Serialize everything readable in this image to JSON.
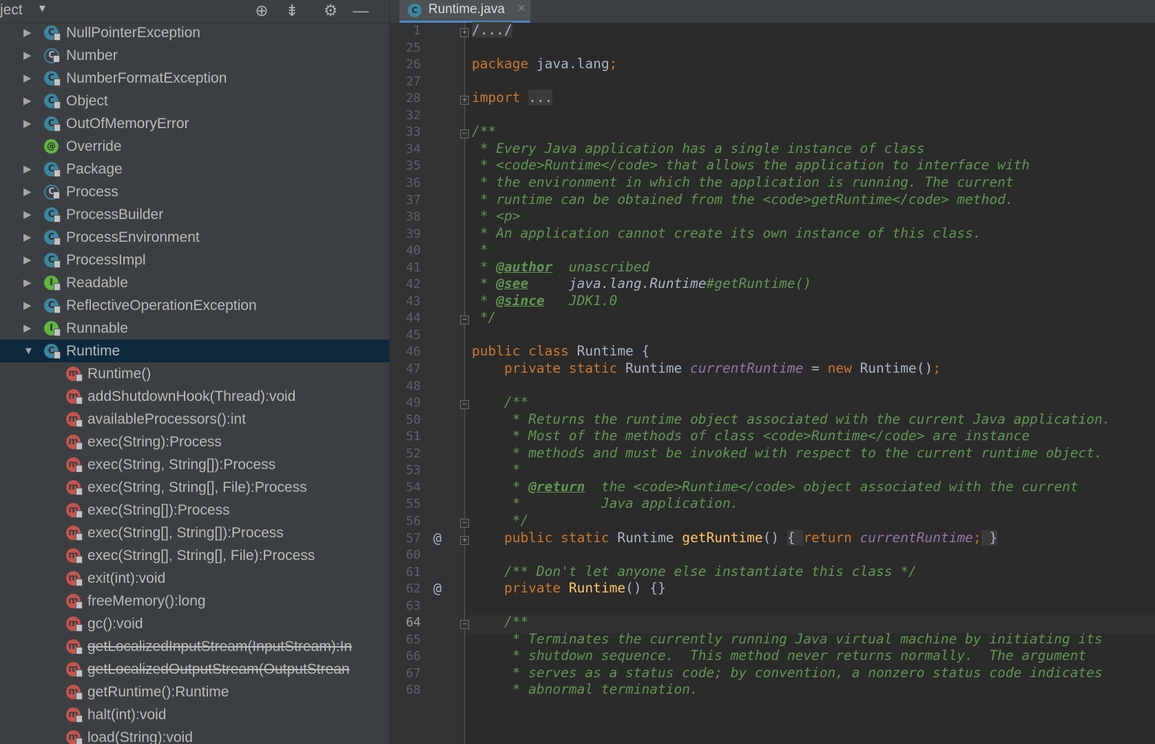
{
  "project_panel": {
    "title": "ject",
    "title_arrow": "▼",
    "icons": [
      "crosshair-icon",
      "collapse-icon",
      "gear-icon",
      "minimize-icon"
    ],
    "classes": [
      {
        "name": "NullPointerException",
        "kind": "exception",
        "icon_letter": "C"
      },
      {
        "name": "Number",
        "kind": "abstract",
        "icon_letter": "C"
      },
      {
        "name": "NumberFormatException",
        "kind": "exception",
        "icon_letter": "C"
      },
      {
        "name": "Object",
        "kind": "class",
        "icon_letter": "C"
      },
      {
        "name": "OutOfMemoryError",
        "kind": "exception",
        "icon_letter": "C"
      },
      {
        "name": "Override",
        "kind": "annotation",
        "icon_letter": "@"
      },
      {
        "name": "Package",
        "kind": "class",
        "icon_letter": "C"
      },
      {
        "name": "Process",
        "kind": "abstract",
        "icon_letter": "C"
      },
      {
        "name": "ProcessBuilder",
        "kind": "class",
        "icon_letter": "C"
      },
      {
        "name": "ProcessEnvironment",
        "kind": "class",
        "icon_letter": "C"
      },
      {
        "name": "ProcessImpl",
        "kind": "class",
        "icon_letter": "C"
      },
      {
        "name": "Readable",
        "kind": "interface",
        "icon_letter": "I"
      },
      {
        "name": "ReflectiveOperationException",
        "kind": "exception",
        "icon_letter": "C"
      },
      {
        "name": "Runnable",
        "kind": "interface",
        "icon_letter": "I"
      }
    ],
    "selected_class": {
      "name": "Runtime",
      "kind": "class",
      "icon_letter": "C",
      "expanded": true
    },
    "members": [
      {
        "label": "Runtime()",
        "deprecated": false,
        "access": "private"
      },
      {
        "label": "addShutdownHook(Thread):void",
        "deprecated": false,
        "access": "public"
      },
      {
        "label": "availableProcessors():int",
        "deprecated": false,
        "access": "public"
      },
      {
        "label": "exec(String):Process",
        "deprecated": false,
        "access": "public"
      },
      {
        "label": "exec(String, String[]):Process",
        "deprecated": false,
        "access": "public"
      },
      {
        "label": "exec(String, String[], File):Process",
        "deprecated": false,
        "access": "public"
      },
      {
        "label": "exec(String[]):Process",
        "deprecated": false,
        "access": "public"
      },
      {
        "label": "exec(String[], String[]):Process",
        "deprecated": false,
        "access": "public"
      },
      {
        "label": "exec(String[], String[], File):Process",
        "deprecated": false,
        "access": "public"
      },
      {
        "label": "exit(int):void",
        "deprecated": false,
        "access": "public"
      },
      {
        "label": "freeMemory():long",
        "deprecated": false,
        "access": "public"
      },
      {
        "label": "gc():void",
        "deprecated": false,
        "access": "public"
      },
      {
        "label": "getLocalizedInputStream(InputStream):In",
        "deprecated": true,
        "access": "public"
      },
      {
        "label": "getLocalizedOutputStream(OutputStrean",
        "deprecated": true,
        "access": "public"
      },
      {
        "label": "getRuntime():Runtime",
        "deprecated": false,
        "access": "public"
      },
      {
        "label": "halt(int):void",
        "deprecated": false,
        "access": "public"
      },
      {
        "label": "load(String):void",
        "deprecated": false,
        "access": "public"
      }
    ]
  },
  "editor": {
    "tab": {
      "label": "Runtime.java",
      "close": "×",
      "icon_letter": "C"
    },
    "current_line": "64",
    "lines": [
      {
        "n": "1",
        "fold": "+",
        "mark": "",
        "tokens": [
          {
            "t": "/.../",
            "c": "fold-box"
          }
        ]
      },
      {
        "n": "25",
        "fold": "",
        "mark": "",
        "tokens": []
      },
      {
        "n": "26",
        "fold": "",
        "mark": "",
        "tokens": [
          {
            "t": "package ",
            "c": "kw"
          },
          {
            "t": "java.lang",
            "c": ""
          },
          {
            "t": ";",
            "c": "kw"
          }
        ]
      },
      {
        "n": "27",
        "fold": "",
        "mark": "",
        "tokens": []
      },
      {
        "n": "28",
        "fold": "+",
        "mark": "",
        "tokens": [
          {
            "t": "import ",
            "c": "kw"
          },
          {
            "t": "...",
            "c": "fold-box"
          }
        ]
      },
      {
        "n": "32",
        "fold": "",
        "mark": "",
        "tokens": []
      },
      {
        "n": "33",
        "fold": "-",
        "mark": "",
        "tokens": [
          {
            "t": "/**",
            "c": "cm"
          }
        ]
      },
      {
        "n": "34",
        "fold": "",
        "mark": "",
        "tokens": [
          {
            "t": " * Every Java application has a single instance of class",
            "c": "cm"
          }
        ]
      },
      {
        "n": "35",
        "fold": "",
        "mark": "",
        "tokens": [
          {
            "t": " * ",
            "c": "cm"
          },
          {
            "t": "<code>",
            "c": "cm"
          },
          {
            "t": "Runtime",
            "c": "cm"
          },
          {
            "t": "</code>",
            "c": "cm"
          },
          {
            "t": " that allows the application to interface with",
            "c": "cm"
          }
        ]
      },
      {
        "n": "36",
        "fold": "",
        "mark": "",
        "tokens": [
          {
            "t": " * the environment in which the application is running. The current",
            "c": "cm"
          }
        ]
      },
      {
        "n": "37",
        "fold": "",
        "mark": "",
        "tokens": [
          {
            "t": " * runtime can be obtained from the ",
            "c": "cm"
          },
          {
            "t": "<code>",
            "c": "cm"
          },
          {
            "t": "getRuntime",
            "c": "cm"
          },
          {
            "t": "</code>",
            "c": "cm"
          },
          {
            "t": " method.",
            "c": "cm"
          }
        ]
      },
      {
        "n": "38",
        "fold": "",
        "mark": "",
        "tokens": [
          {
            "t": " * ",
            "c": "cm"
          },
          {
            "t": "<p>",
            "c": "cm"
          }
        ]
      },
      {
        "n": "39",
        "fold": "",
        "mark": "",
        "tokens": [
          {
            "t": " * An application cannot create its own instance of this class.",
            "c": "cm"
          }
        ]
      },
      {
        "n": "40",
        "fold": "",
        "mark": "",
        "tokens": [
          {
            "t": " *",
            "c": "cm"
          }
        ]
      },
      {
        "n": "41",
        "fold": "",
        "mark": "",
        "tokens": [
          {
            "t": " * ",
            "c": "cm"
          },
          {
            "t": "@author",
            "c": "cm tag"
          },
          {
            "t": "  unascribed",
            "c": "cm"
          }
        ]
      },
      {
        "n": "42",
        "fold": "",
        "mark": "",
        "tokens": [
          {
            "t": " * ",
            "c": "cm"
          },
          {
            "t": "@see",
            "c": "cm tag"
          },
          {
            "t": "     ",
            "c": "cm"
          },
          {
            "t": "java.lang.Runtime",
            "c": "ref cm"
          },
          {
            "t": "#getRuntime()",
            "c": "cm"
          }
        ]
      },
      {
        "n": "43",
        "fold": "",
        "mark": "",
        "tokens": [
          {
            "t": " * ",
            "c": "cm"
          },
          {
            "t": "@since",
            "c": "cm tag"
          },
          {
            "t": "   JDK1.0",
            "c": "cm"
          }
        ]
      },
      {
        "n": "44",
        "fold": "-",
        "mark": "",
        "tokens": [
          {
            "t": " */",
            "c": "cm"
          }
        ]
      },
      {
        "n": "45",
        "fold": "",
        "mark": "",
        "tokens": []
      },
      {
        "n": "46",
        "fold": "",
        "mark": "",
        "tokens": [
          {
            "t": "public class ",
            "c": "kw"
          },
          {
            "t": "Runtime {",
            "c": ""
          }
        ]
      },
      {
        "n": "47",
        "fold": "",
        "mark": "",
        "tokens": [
          {
            "t": "    private static ",
            "c": "kw"
          },
          {
            "t": "Runtime ",
            "c": ""
          },
          {
            "t": "currentRuntime",
            "c": "fld"
          },
          {
            "t": " = ",
            "c": ""
          },
          {
            "t": "new ",
            "c": "kw"
          },
          {
            "t": "Runtime()",
            "c": ""
          },
          {
            "t": ";",
            "c": "kw"
          }
        ]
      },
      {
        "n": "48",
        "fold": "",
        "mark": "",
        "tokens": []
      },
      {
        "n": "49",
        "fold": "-",
        "mark": "",
        "tokens": [
          {
            "t": "    /**",
            "c": "cm"
          }
        ]
      },
      {
        "n": "50",
        "fold": "",
        "mark": "",
        "tokens": [
          {
            "t": "     * Returns the runtime object associated with the current Java application.",
            "c": "cm"
          }
        ]
      },
      {
        "n": "51",
        "fold": "",
        "mark": "",
        "tokens": [
          {
            "t": "     * Most of the methods of class ",
            "c": "cm"
          },
          {
            "t": "<code>",
            "c": "cm"
          },
          {
            "t": "Runtime",
            "c": "cm"
          },
          {
            "t": "</code>",
            "c": "cm"
          },
          {
            "t": " are instance",
            "c": "cm"
          }
        ]
      },
      {
        "n": "52",
        "fold": "",
        "mark": "",
        "tokens": [
          {
            "t": "     * methods and must be invoked with respect to the current runtime object.",
            "c": "cm"
          }
        ]
      },
      {
        "n": "53",
        "fold": "",
        "mark": "",
        "tokens": [
          {
            "t": "     *",
            "c": "cm"
          }
        ]
      },
      {
        "n": "54",
        "fold": "",
        "mark": "",
        "tokens": [
          {
            "t": "     * ",
            "c": "cm"
          },
          {
            "t": "@return",
            "c": "cm tag"
          },
          {
            "t": "  the ",
            "c": "cm"
          },
          {
            "t": "<code>",
            "c": "cm"
          },
          {
            "t": "Runtime",
            "c": "cm"
          },
          {
            "t": "</code>",
            "c": "cm"
          },
          {
            "t": " object associated with the current",
            "c": "cm"
          }
        ]
      },
      {
        "n": "55",
        "fold": "",
        "mark": "",
        "tokens": [
          {
            "t": "     *          Java application.",
            "c": "cm"
          }
        ]
      },
      {
        "n": "56",
        "fold": "-",
        "mark": "",
        "tokens": [
          {
            "t": "     */",
            "c": "cm"
          }
        ]
      },
      {
        "n": "57",
        "fold": "+",
        "mark": "@",
        "tokens": [
          {
            "t": "    public static ",
            "c": "kw"
          },
          {
            "t": "Runtime ",
            "c": ""
          },
          {
            "t": "getRuntime",
            "c": "fn"
          },
          {
            "t": "() ",
            "c": ""
          },
          {
            "t": "{ ",
            "c": "fold-box"
          },
          {
            "t": "return ",
            "c": "kw"
          },
          {
            "t": "currentRuntime",
            "c": "fld"
          },
          {
            "t": ";",
            "c": "kw"
          },
          {
            "t": " }",
            "c": "fold-box"
          }
        ]
      },
      {
        "n": "60",
        "fold": "",
        "mark": "",
        "tokens": []
      },
      {
        "n": "61",
        "fold": "",
        "mark": "",
        "tokens": [
          {
            "t": "    /** Don't let anyone else instantiate this class */",
            "c": "cm"
          }
        ]
      },
      {
        "n": "62",
        "fold": "",
        "mark": "@",
        "tokens": [
          {
            "t": "    private ",
            "c": "kw"
          },
          {
            "t": "Runtime",
            "c": "fn"
          },
          {
            "t": "() {}",
            "c": ""
          }
        ]
      },
      {
        "n": "63",
        "fold": "",
        "mark": "",
        "tokens": []
      },
      {
        "n": "64",
        "fold": "-",
        "mark": "",
        "tokens": [
          {
            "t": "    /**",
            "c": "cm"
          }
        ]
      },
      {
        "n": "65",
        "fold": "",
        "mark": "",
        "tokens": [
          {
            "t": "     * Terminates the currently running Java virtual machine by initiating its",
            "c": "cm"
          }
        ]
      },
      {
        "n": "66",
        "fold": "",
        "mark": "",
        "tokens": [
          {
            "t": "     * shutdown sequence.  This method never returns normally.  The argument",
            "c": "cm"
          }
        ]
      },
      {
        "n": "67",
        "fold": "",
        "mark": "",
        "tokens": [
          {
            "t": "     * serves as a status code; by convention, a nonzero status code indicates",
            "c": "cm"
          }
        ]
      },
      {
        "n": "68",
        "fold": "",
        "mark": "",
        "tokens": [
          {
            "t": "     * abnormal termination.",
            "c": "cm"
          }
        ]
      }
    ]
  }
}
